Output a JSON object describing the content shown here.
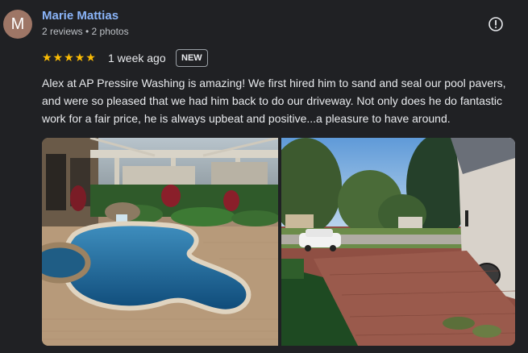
{
  "review": {
    "avatar_letter": "M",
    "author": "Marie Mattias",
    "author_meta": "2 reviews • 2 photos",
    "stars": "★★★★★",
    "rating": 5,
    "time": "1 week ago",
    "badge": "NEW",
    "text": "Alex at AP Pressire Washing is amazing! We first hired him to sand and seal our pool pavers, and were so pleased that we had him back to do our driveway. Not only does he do fantastic work for a fair price, he is always upbeat and positive...a pleasure to have around."
  },
  "colors": {
    "background": "#202124",
    "author_link": "#8ab4f8",
    "star": "#fbbc04",
    "avatar": "#9e7666"
  },
  "icons": {
    "flag": "flag-icon"
  },
  "photos": [
    {
      "subject": "pool-photo"
    },
    {
      "subject": "driveway-photo"
    }
  ]
}
